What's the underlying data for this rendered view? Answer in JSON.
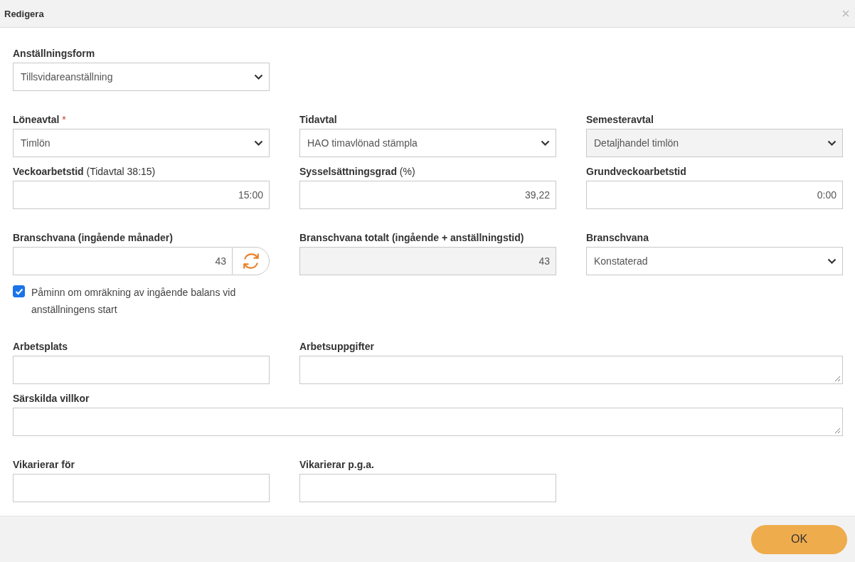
{
  "dialog": {
    "title": "Redigera"
  },
  "rows": [
    [
      {
        "kind": "select",
        "label": "Anställningsform",
        "value": "Tillsvidareanställning",
        "disabled": false
      }
    ],
    [
      {
        "kind": "select",
        "label": "Löneavtal",
        "required_mark": "*",
        "value": "Timlön",
        "disabled": false
      },
      {
        "kind": "select",
        "label": "Tidavtal",
        "value": "HAO timavlönad stämpla",
        "disabled": false
      },
      {
        "kind": "select",
        "label": "Semesteravtal",
        "value": "Detaljhandel timlön",
        "disabled": true
      }
    ],
    [
      {
        "kind": "input",
        "label": "Veckoarbetstid",
        "label_note": "(Tidavtal 38:15)",
        "value": "15:00",
        "disabled": false
      },
      {
        "kind": "input",
        "label": "Sysselsättningsgrad",
        "label_note": "(%)",
        "value": "39,22",
        "disabled": false
      },
      {
        "kind": "input",
        "label": "Grundveckoarbetstid",
        "value": "0:00",
        "disabled": false
      }
    ],
    [
      {
        "kind": "refresh-input",
        "label": "Branschvana (ingående månader)",
        "value": "43",
        "disabled": false,
        "reminder": {
          "label": "Påminn om omräkning av ingående balans vid anställningens start",
          "checked": true
        }
      },
      {
        "kind": "input",
        "label": "Branschvana totalt (ingående + anställningstid)",
        "value": "43",
        "disabled": true
      },
      {
        "kind": "select",
        "label": "Branschvana",
        "value": "Konstaterad",
        "disabled": false
      }
    ],
    [
      {
        "kind": "input",
        "label": "Arbetsplats",
        "disabled": false
      },
      {
        "kind": "wide-textarea",
        "label": "Arbetsuppgifter",
        "disabled": false
      }
    ],
    [
      {
        "kind": "full-textarea",
        "label": "Särskilda villkor",
        "disabled": false
      }
    ],
    [
      {
        "kind": "input",
        "label": "Vikarierar för",
        "disabled": false
      },
      {
        "kind": "input",
        "label": "Vikarierar p.g.a.",
        "disabled": false
      }
    ]
  ],
  "footer": {
    "ok_button": "OK"
  }
}
